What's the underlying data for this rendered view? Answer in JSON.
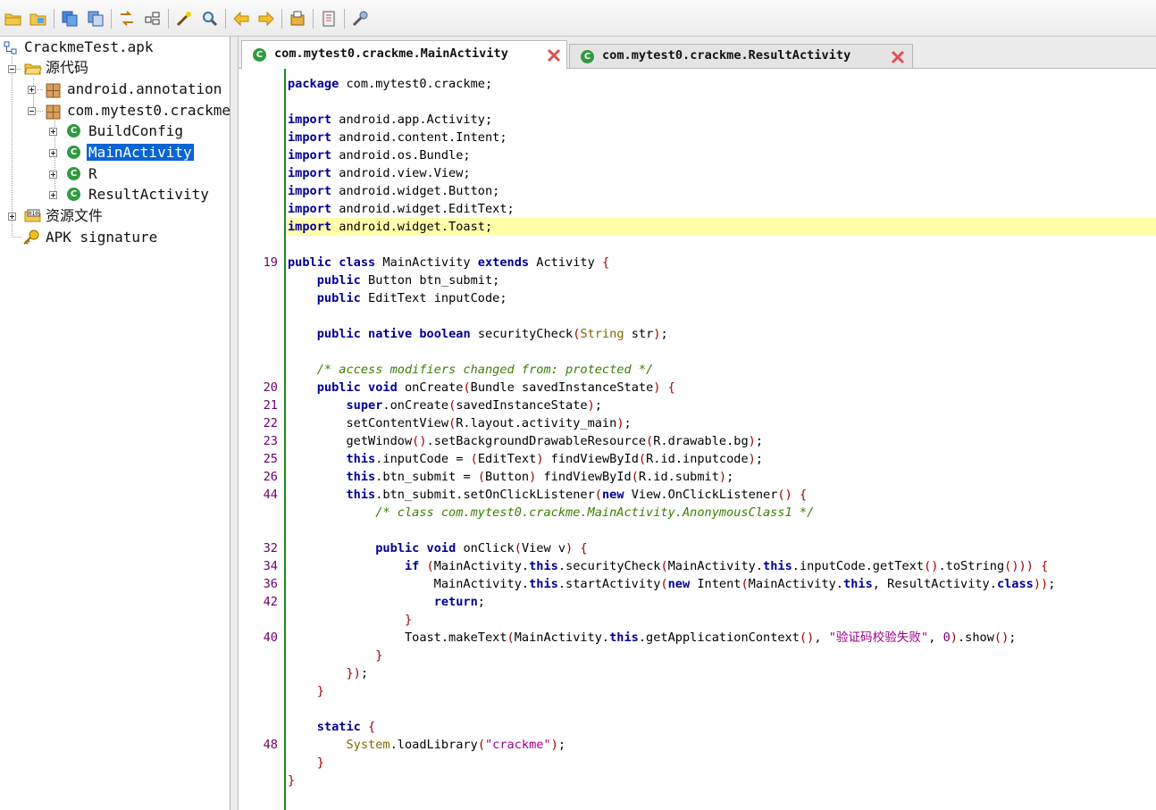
{
  "toolbar": {
    "buttons": [
      "open-file-icon",
      "open-folder-icon",
      "save-icon",
      "save-all-icon",
      "sync-tree-icon",
      "flatten-packages-icon",
      "decompile-wand-icon",
      "search-icon",
      "back-arrow-icon",
      "forward-arrow-icon",
      "log-icon",
      "preferences-icon",
      "settings-wrench-icon"
    ]
  },
  "tree": {
    "root": "CrackmeTest.apk",
    "source_folder": "源代码",
    "packages": [
      "android.annotation",
      "com.mytest0.crackme"
    ],
    "classes": [
      "BuildConfig",
      "MainActivity",
      "R",
      "ResultActivity"
    ],
    "resources": "资源文件",
    "signature": "APK signature",
    "selected": "MainActivity"
  },
  "tabs": [
    {
      "title": "com.mytest0.crackme.MainActivity",
      "active": true
    },
    {
      "title": "com.mytest0.crackme.ResultActivity",
      "active": false
    }
  ],
  "editor": {
    "highlight_color": "#ffffaa",
    "gutter_color": "#1d8a1d",
    "line_numbers": [
      "",
      "",
      "",
      "",
      "",
      "",
      "",
      "",
      "",
      "",
      "19",
      "",
      "",
      "",
      "",
      "",
      "",
      "20",
      "21",
      "22",
      "23",
      "25",
      "26",
      "44",
      "",
      "",
      "32",
      "34",
      "36",
      "42",
      "",
      "40",
      "",
      "",
      "",
      "",
      "",
      "48",
      "",
      ""
    ],
    "code": [
      "package com.mytest0.crackme;",
      "",
      "import android.app.Activity;",
      "import android.content.Intent;",
      "import android.os.Bundle;",
      "import android.view.View;",
      "import android.widget.Button;",
      "import android.widget.EditText;",
      "import android.widget.Toast;",
      "",
      "public class MainActivity extends Activity {",
      "    public Button btn_submit;",
      "    public EditText inputCode;",
      "",
      "    public native boolean securityCheck(String str);",
      "",
      "    /* access modifiers changed from: protected */",
      "    public void onCreate(Bundle savedInstanceState) {",
      "        super.onCreate(savedInstanceState);",
      "        setContentView(R.layout.activity_main);",
      "        getWindow().setBackgroundDrawableResource(R.drawable.bg);",
      "        this.inputCode = (EditText) findViewById(R.id.inputcode);",
      "        this.btn_submit = (Button) findViewById(R.id.submit);",
      "        this.btn_submit.setOnClickListener(new View.OnClickListener() {",
      "            /* class com.mytest0.crackme.MainActivity.AnonymousClass1 */",
      "",
      "            public void onClick(View v) {",
      "                if (MainActivity.this.securityCheck(MainActivity.this.inputCode.getText().toString())) {",
      "                    MainActivity.this.startActivity(new Intent(MainActivity.this, ResultActivity.class));",
      "                    return;",
      "                }",
      "                Toast.makeText(MainActivity.this.getApplicationContext(), \"验证码校验失败\", 0).show();",
      "            }",
      "        });",
      "    }",
      "",
      "    static {",
      "        System.loadLibrary(\"crackme\");",
      "    }",
      "}"
    ]
  }
}
